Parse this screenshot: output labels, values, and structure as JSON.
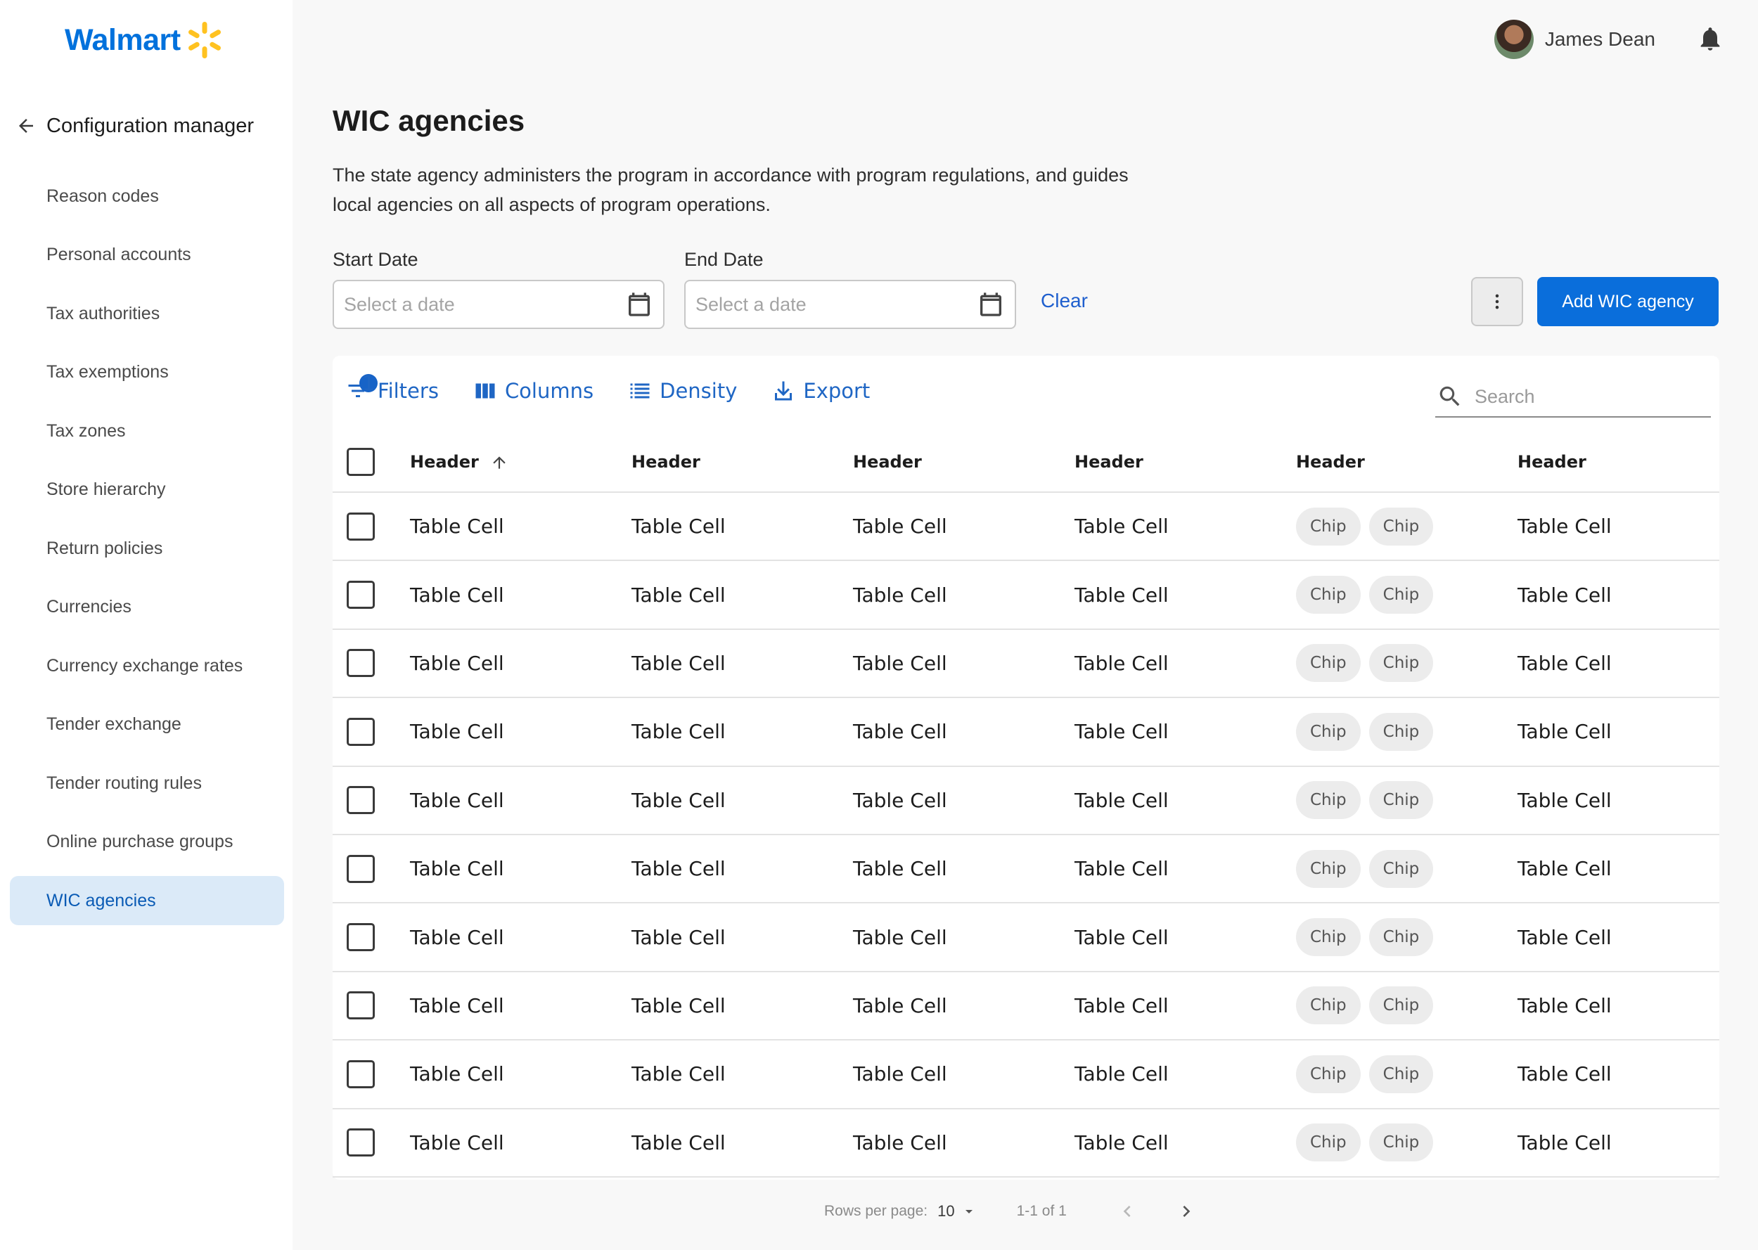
{
  "brand": {
    "name": "Walmart",
    "color": "#0071dc",
    "spark_color": "#ffc220"
  },
  "sidebar": {
    "back_label": "Configuration manager",
    "items": [
      {
        "label": "Reason codes",
        "active": false
      },
      {
        "label": "Personal accounts",
        "active": false
      },
      {
        "label": "Tax authorities",
        "active": false
      },
      {
        "label": "Tax exemptions",
        "active": false
      },
      {
        "label": "Tax zones",
        "active": false
      },
      {
        "label": "Store hierarchy",
        "active": false
      },
      {
        "label": "Return policies",
        "active": false
      },
      {
        "label": "Currencies",
        "active": false
      },
      {
        "label": "Currency exchange rates",
        "active": false
      },
      {
        "label": "Tender exchange",
        "active": false
      },
      {
        "label": "Tender routing rules",
        "active": false
      },
      {
        "label": "Online purchase groups",
        "active": false
      },
      {
        "label": "WIC agencies",
        "active": true
      }
    ]
  },
  "header": {
    "user_name": "James Dean",
    "avatar_icon": "avatar",
    "notification_icon": "bell-icon"
  },
  "page": {
    "title": "WIC agencies",
    "description": "The state agency administers the program in accordance with program regulations, and guides local agencies on all aspects of program operations."
  },
  "filters": {
    "start_date": {
      "label": "Start Date",
      "placeholder": "Select a date"
    },
    "end_date": {
      "label": "End Date",
      "placeholder": "Select a date"
    },
    "clear_label": "Clear",
    "add_button_label": "Add WIC agency",
    "accent_color": "#0a6edb"
  },
  "toolbar": {
    "filters_label": "Filters",
    "filters_count": "1",
    "columns_label": "Columns",
    "density_label": "Density",
    "export_label": "Export",
    "search_placeholder": "Search"
  },
  "table": {
    "headers": [
      "Header",
      "Header",
      "Header",
      "Header",
      "Header",
      "Header"
    ],
    "sort_column": 0,
    "sort_direction": "ascending",
    "rows": [
      {
        "cells": [
          "Table Cell",
          "Table Cell",
          "Table Cell",
          "Table Cell"
        ],
        "chips": [
          "Chip",
          "Chip"
        ],
        "last": "Table Cell"
      },
      {
        "cells": [
          "Table Cell",
          "Table Cell",
          "Table Cell",
          "Table Cell"
        ],
        "chips": [
          "Chip",
          "Chip"
        ],
        "last": "Table Cell"
      },
      {
        "cells": [
          "Table Cell",
          "Table Cell",
          "Table Cell",
          "Table Cell"
        ],
        "chips": [
          "Chip",
          "Chip"
        ],
        "last": "Table Cell"
      },
      {
        "cells": [
          "Table Cell",
          "Table Cell",
          "Table Cell",
          "Table Cell"
        ],
        "chips": [
          "Chip",
          "Chip"
        ],
        "last": "Table Cell"
      },
      {
        "cells": [
          "Table Cell",
          "Table Cell",
          "Table Cell",
          "Table Cell"
        ],
        "chips": [
          "Chip",
          "Chip"
        ],
        "last": "Table Cell"
      },
      {
        "cells": [
          "Table Cell",
          "Table Cell",
          "Table Cell",
          "Table Cell"
        ],
        "chips": [
          "Chip",
          "Chip"
        ],
        "last": "Table Cell"
      },
      {
        "cells": [
          "Table Cell",
          "Table Cell",
          "Table Cell",
          "Table Cell"
        ],
        "chips": [
          "Chip",
          "Chip"
        ],
        "last": "Table Cell"
      },
      {
        "cells": [
          "Table Cell",
          "Table Cell",
          "Table Cell",
          "Table Cell"
        ],
        "chips": [
          "Chip",
          "Chip"
        ],
        "last": "Table Cell"
      },
      {
        "cells": [
          "Table Cell",
          "Table Cell",
          "Table Cell",
          "Table Cell"
        ],
        "chips": [
          "Chip",
          "Chip"
        ],
        "last": "Table Cell"
      },
      {
        "cells": [
          "Table Cell",
          "Table Cell",
          "Table Cell",
          "Table Cell"
        ],
        "chips": [
          "Chip",
          "Chip"
        ],
        "last": "Table Cell"
      }
    ]
  },
  "pagination": {
    "rows_per_page_label": "Rows per page:",
    "rows_per_page_value": "10",
    "range_label": "1-1 of 1"
  }
}
